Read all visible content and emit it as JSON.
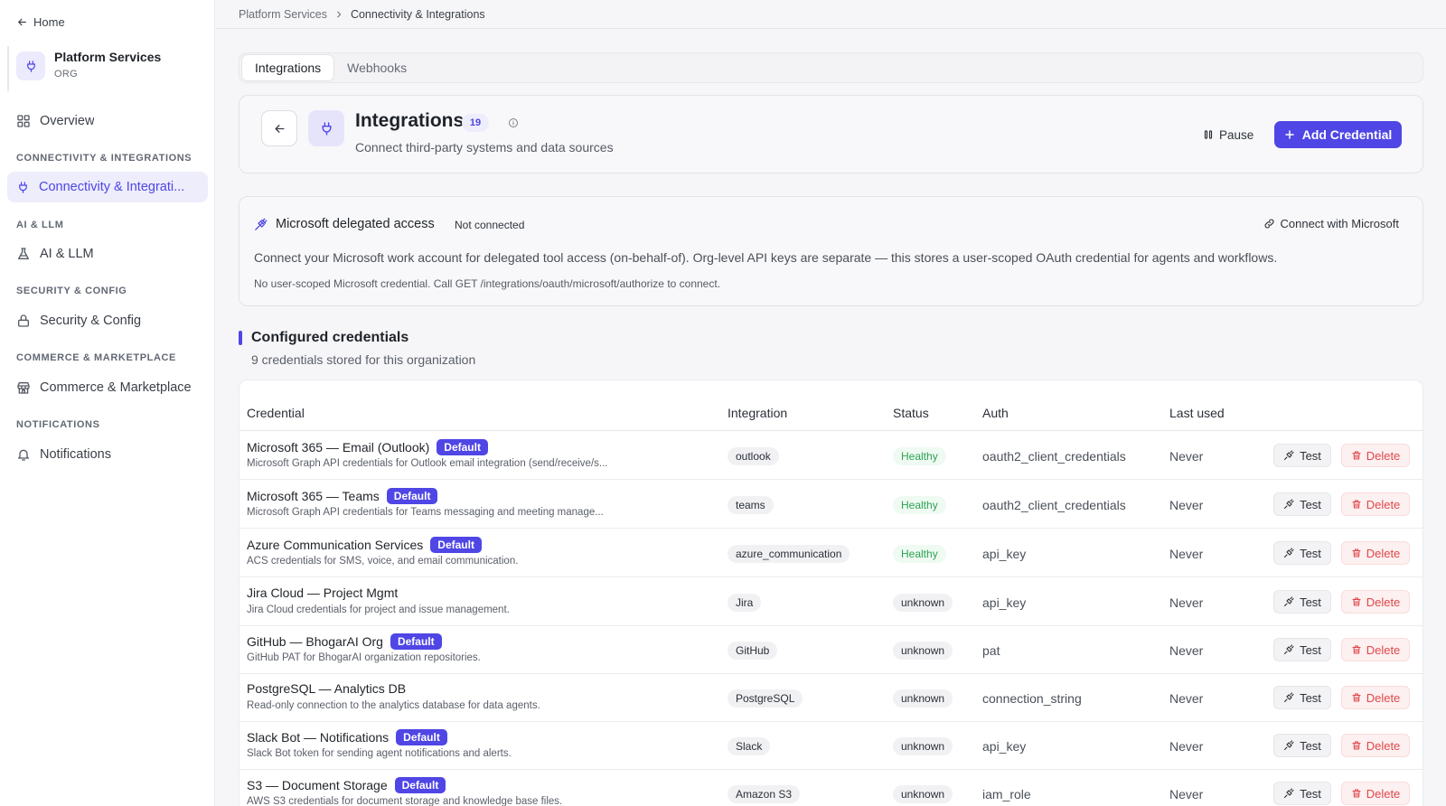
{
  "sidebar": {
    "home": "Home",
    "org_name": "Platform Services",
    "org_type": "ORG",
    "overview": "Overview",
    "sections": [
      {
        "heading": "CONNECTIVITY & INTEGRATIONS",
        "item": "Connectivity & Integrati...",
        "icon": "plug-icon",
        "active": true
      },
      {
        "heading": "AI & LLM",
        "item": "AI & LLM",
        "icon": "flask-icon",
        "active": false
      },
      {
        "heading": "SECURITY & CONFIG",
        "item": "Security & Config",
        "icon": "lock-icon",
        "active": false
      },
      {
        "heading": "COMMERCE & MARKETPLACE",
        "item": "Commerce & Marketplace",
        "icon": "store-icon",
        "active": false
      },
      {
        "heading": "NOTIFICATIONS",
        "item": "Notifications",
        "icon": "bell-icon",
        "active": false
      }
    ]
  },
  "breadcrumb": {
    "parent": "Platform Services",
    "current": "Connectivity & Integrations"
  },
  "tabs": [
    "Integrations",
    "Webhooks"
  ],
  "header": {
    "title": "Integrations",
    "count": "19",
    "subtitle": "Connect third-party systems and data sources",
    "pause_label": "Pause",
    "add_label": "Add Credential"
  },
  "microsoft": {
    "title": "Microsoft delegated access",
    "status": "Not connected",
    "connect_label": "Connect with Microsoft",
    "description": "Connect your Microsoft work account for delegated tool access (on-behalf-of). Org-level API keys are separate — this stores a user-scoped OAuth credential for agents and workflows.",
    "note": "No user-scoped Microsoft credential. Call GET /integrations/oauth/microsoft/authorize to connect."
  },
  "credentials_section": {
    "title": "Configured credentials",
    "subtitle": "9 credentials stored for this organization"
  },
  "table": {
    "headers": {
      "credential": "Credential",
      "integration": "Integration",
      "status": "Status",
      "auth": "Auth",
      "last_used": "Last used"
    },
    "default_label": "Default",
    "test_label": "Test",
    "delete_label": "Delete",
    "rows": [
      {
        "name": "Microsoft 365 — Email (Outlook)",
        "is_default": true,
        "desc": "Microsoft Graph API credentials for Outlook email integration (send/receive/s...",
        "integration": "outlook",
        "status": "Healthy",
        "auth": "oauth2_client_credentials",
        "last_used": "Never"
      },
      {
        "name": "Microsoft 365 — Teams",
        "is_default": true,
        "desc": "Microsoft Graph API credentials for Teams messaging and meeting manage...",
        "integration": "teams",
        "status": "Healthy",
        "auth": "oauth2_client_credentials",
        "last_used": "Never"
      },
      {
        "name": "Azure Communication Services",
        "is_default": true,
        "desc": "ACS credentials for SMS, voice, and email communication.",
        "integration": "azure_communication",
        "status": "Healthy",
        "auth": "api_key",
        "last_used": "Never"
      },
      {
        "name": "Jira Cloud — Project Mgmt",
        "is_default": false,
        "desc": "Jira Cloud credentials for project and issue management.",
        "integration": "Jira",
        "status": "unknown",
        "auth": "api_key",
        "last_used": "Never"
      },
      {
        "name": "GitHub — BhogarAI Org",
        "is_default": true,
        "desc": "GitHub PAT for BhogarAI organization repositories.",
        "integration": "GitHub",
        "status": "unknown",
        "auth": "pat",
        "last_used": "Never"
      },
      {
        "name": "PostgreSQL — Analytics DB",
        "is_default": false,
        "desc": "Read-only connection to the analytics database for data agents.",
        "integration": "PostgreSQL",
        "status": "unknown",
        "auth": "connection_string",
        "last_used": "Never"
      },
      {
        "name": "Slack Bot — Notifications",
        "is_default": true,
        "desc": "Slack Bot token for sending agent notifications and alerts.",
        "integration": "Slack",
        "status": "unknown",
        "auth": "api_key",
        "last_used": "Never"
      },
      {
        "name": "S3 — Document Storage",
        "is_default": true,
        "desc": "AWS S3 credentials for document storage and knowledge base files.",
        "integration": "Amazon S3",
        "status": "unknown",
        "auth": "iam_role",
        "last_used": "Never"
      }
    ]
  },
  "colors": {
    "accent": "#4f46e5",
    "healthy": "#2ea256",
    "danger": "#e0484c"
  }
}
